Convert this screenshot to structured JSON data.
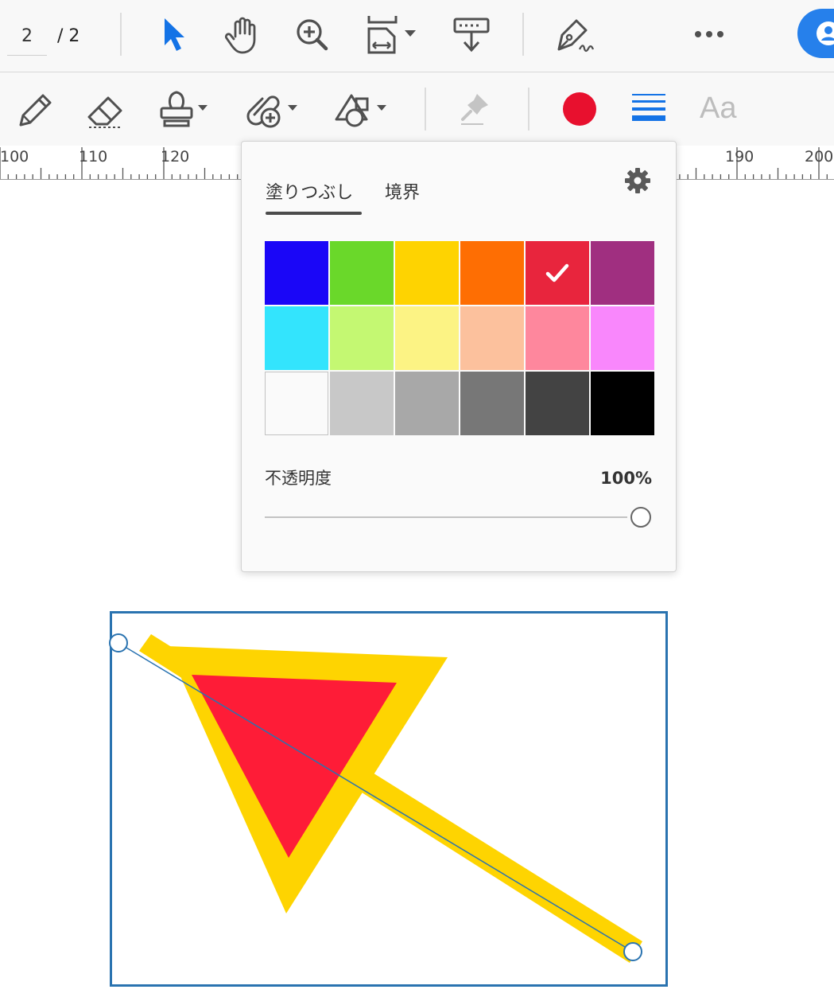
{
  "toolbar": {
    "page_number": "2",
    "page_total": "/ 2",
    "tools": [
      {
        "name": "select-tool",
        "icon": "arrow-pointer-icon",
        "active": true
      },
      {
        "name": "hand-tool",
        "icon": "hand-icon"
      },
      {
        "name": "zoom-tool",
        "icon": "zoom-in-icon"
      },
      {
        "name": "fit-page",
        "icon": "fit-page-icon"
      },
      {
        "name": "scroll-mode",
        "icon": "scroll-down-icon"
      },
      {
        "name": "sign",
        "icon": "pen-sign-icon"
      },
      {
        "name": "more",
        "icon": "more-icon"
      }
    ],
    "accent_color": "#2680eb"
  },
  "subtoolbar": {
    "tools": [
      "pencil-icon",
      "eraser-icon",
      "stamp-icon",
      "attach-icon",
      "shape-icon",
      "pin-icon",
      "color-icon",
      "line-style-icon",
      "text-icon"
    ],
    "current_color": "#e8102e",
    "line_color": "#1473e6",
    "text_label": "Aa"
  },
  "ruler": {
    "labels": [
      "100",
      "110",
      "120",
      "190",
      "200"
    ]
  },
  "color_popup": {
    "tabs": [
      {
        "label": "塗りつぶし",
        "selected": true
      },
      {
        "label": "境界",
        "selected": false
      }
    ],
    "swatches": [
      [
        "#1a06f7",
        "#6ad82a",
        "#fed301",
        "#fe6e03",
        "#e8253d",
        "#a02f80"
      ],
      [
        "#33e4fd",
        "#c4f872",
        "#fcf384",
        "#fcc19d",
        "#fe879d",
        "#f987fc"
      ],
      [
        "#fafafa",
        "#c8c8c8",
        "#a8a8a8",
        "#777777",
        "#434343",
        "#000000"
      ]
    ],
    "selected_swatch": {
      "row": 0,
      "col": 4
    },
    "opacity_label": "不透明度",
    "opacity_value": "100%",
    "opacity": 1.0
  },
  "annotation": {
    "stroke_color": "#fed401",
    "fill_color": "#fe1c37",
    "selection_color": "#2a73b0"
  }
}
